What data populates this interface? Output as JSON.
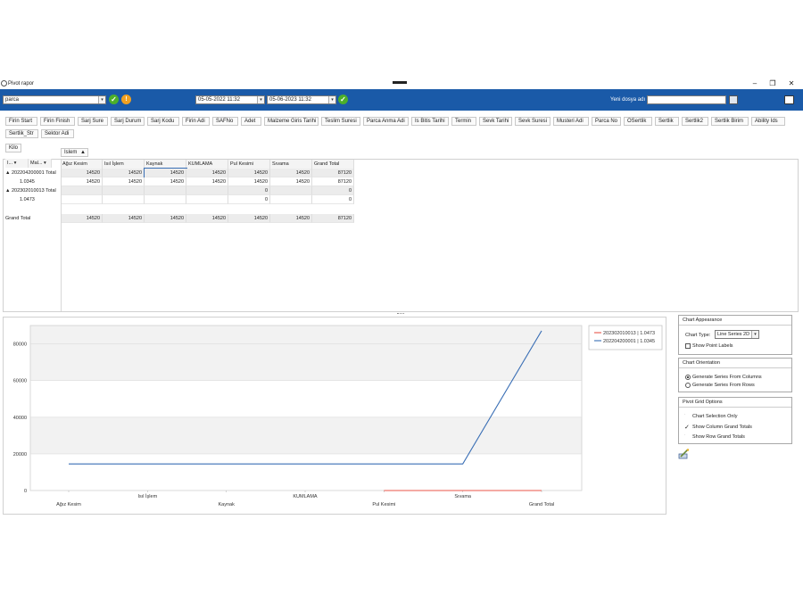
{
  "window": {
    "title": "Pivot rapor"
  },
  "toolbar": {
    "main_combo": "parca",
    "date_from": "05-05-2022 11:32",
    "date_to": "05-06-2023 11:32",
    "new_file_label": "Yeni dosya adı",
    "new_file_value": ""
  },
  "filter_fields": [
    "Firin Start",
    "Firin Finish",
    "Sarj Sure",
    "Sarj Durum",
    "Sarj Kodu",
    "Firin Adi",
    "SAFNo",
    "Adet",
    "Malzeme Giris Tarihi",
    "Teslim Suresi",
    "Parca Anma Adi",
    "Is Bitis Tarihi",
    "Termin",
    "Sevk Tarihi",
    "Sevk Suresi",
    "Musteri Adi",
    "Parca No",
    "OSertlik",
    "Sertlik",
    "Sertlik2",
    "Sertlik Birim",
    "Ability Ids"
  ],
  "filter_fields_row2": [
    "Sertlik_Str",
    "Sektor Adi"
  ],
  "data_field": "Kilo",
  "column_field": "Islem",
  "row_fields": [
    "I...",
    "Mal..."
  ],
  "pivot": {
    "columns": [
      "Ağız Kesim",
      "Isıl İşlem",
      "Kaynak",
      "KUMLAMA",
      "Pul Kesimi",
      "Sıvama",
      "Grand Total"
    ],
    "rows": [
      {
        "label": "▲ 202204200001 Total",
        "values": [
          "14520",
          "14520",
          "14520",
          "14520",
          "14520",
          "14520",
          "87120"
        ]
      },
      {
        "label": "1.0345",
        "values": [
          "14520",
          "14520",
          "14520",
          "14520",
          "14520",
          "14520",
          "87120"
        ]
      },
      {
        "label": "▲ 202302010013 Total",
        "values": [
          "",
          "",
          "",
          "",
          "0",
          "",
          "0"
        ]
      },
      {
        "label": "1.0473",
        "values": [
          "",
          "",
          "",
          "",
          "0",
          "",
          "0"
        ]
      },
      {
        "label": "Grand Total",
        "values": [
          "14520",
          "14520",
          "14520",
          "14520",
          "14520",
          "14520",
          "87120"
        ]
      }
    ]
  },
  "chart_data": {
    "type": "line",
    "categories": [
      "Ağız Kesim",
      "Isıl İşlem",
      "Kaynak",
      "KUMLAMA",
      "Pul Kesimi",
      "Sıvama",
      "Grand Total"
    ],
    "series": [
      {
        "name": "202302010013 | 1.0473",
        "color": "#e8554a",
        "values": [
          null,
          null,
          null,
          null,
          0,
          null,
          0
        ]
      },
      {
        "name": "202204200001 | 1.0345",
        "color": "#3a6fb5",
        "values": [
          14520,
          14520,
          14520,
          14520,
          14520,
          14520,
          87120
        ]
      }
    ],
    "yticks": [
      "0",
      "20000",
      "40000",
      "60000",
      "80000"
    ],
    "ylim": [
      0,
      90000
    ],
    "legend": "top-right",
    "grid": true
  },
  "options": {
    "appearance_title": "Chart Appearance",
    "chart_type_label": "Chart Type:",
    "chart_type_value": "Line Series 2D",
    "show_point_labels": "Show Point Labels",
    "orientation_title": "Chart Orientation",
    "from_columns": "Generate Series From Columns",
    "from_rows": "Generate Series From Rows",
    "grid_options_title": "Pivot Grid Options",
    "selection_only": "Chart Selection Only",
    "col_grand_totals": "Show Column Grand Totals",
    "row_grand_totals": "Show Row Grand Totals"
  },
  "colors": {
    "toolbar": "#1a5aa8",
    "accent_ok": "#4caf2a",
    "accent_warn": "#f0a020"
  }
}
